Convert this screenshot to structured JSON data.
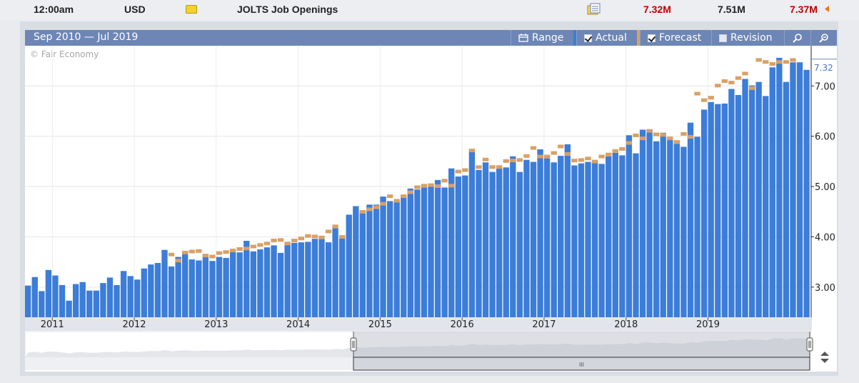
{
  "event_row": {
    "time": "12:00am",
    "currency": "USD",
    "event_name": "JOLTS Job Openings",
    "actual": "7.32M",
    "forecast": "7.51M",
    "previous": "7.37M",
    "impact_icon": "yellow-folder-icon",
    "detail_icon": "document-icon",
    "actual_color": "#c00000",
    "previous_color": "#c00000"
  },
  "chart_header": {
    "range_text": "Sep 2010 — Jul 2019",
    "range_label": "Range",
    "actual_label": "Actual",
    "forecast_label": "Forecast",
    "revision_label": "Revision",
    "actual_checked": true,
    "forecast_checked": true,
    "revision_checked": false,
    "zoom_in_icon": "zoom-in-icon",
    "zoom_out_icon": "zoom-out-icon"
  },
  "copyright": "© Fair Economy",
  "navigator": {
    "scroll_grip": "III"
  },
  "chart_data": {
    "type": "bar",
    "ylim": [
      2.4,
      7.8
    ],
    "yticks": [
      3.0,
      4.0,
      5.0,
      6.0,
      7.0
    ],
    "ytick_labels": [
      "3.00",
      "4.00",
      "5.00",
      "6.00",
      "7.00"
    ],
    "latest_value_label": "7.32",
    "x_labels": [
      "2011",
      "2012",
      "2013",
      "2014",
      "2015",
      "2016",
      "2017",
      "2018",
      "2019"
    ],
    "first_label_index": 4,
    "legend": [
      "Actual",
      "Forecast"
    ],
    "colors": {
      "actual": "#3b7dd8",
      "forecast": "#d9a066",
      "grid": "#e6e6e6"
    },
    "grid": true,
    "actual": [
      3.03,
      3.2,
      2.92,
      3.34,
      3.23,
      3.04,
      2.73,
      3.06,
      3.1,
      2.93,
      2.93,
      3.08,
      3.19,
      3.04,
      3.32,
      3.22,
      3.15,
      3.37,
      3.45,
      3.48,
      3.74,
      3.41,
      3.6,
      3.72,
      3.55,
      3.53,
      3.64,
      3.52,
      3.6,
      3.58,
      3.7,
      3.69,
      3.92,
      3.71,
      3.75,
      3.79,
      3.83,
      3.68,
      3.88,
      3.88,
      3.89,
      3.9,
      3.96,
      3.97,
      3.89,
      4.17,
      3.98,
      4.44,
      4.61,
      4.52,
      4.64,
      4.64,
      4.8,
      4.71,
      4.72,
      4.83,
      4.96,
      4.94,
      4.98,
      5.0,
      5.13,
      4.98,
      5.36,
      5.2,
      5.22,
      5.72,
      5.33,
      5.48,
      5.29,
      5.37,
      5.38,
      5.6,
      5.29,
      5.53,
      5.49,
      5.74,
      5.56,
      5.48,
      5.61,
      5.84,
      5.42,
      5.46,
      5.49,
      5.5,
      5.45,
      5.6,
      5.67,
      5.62,
      6.02,
      5.66,
      6.13,
      6.13,
      5.9,
      6.07,
      5.94,
      5.85,
      5.79,
      6.27,
      5.99,
      6.53,
      6.68,
      6.64,
      6.65,
      6.94,
      6.82,
      7.14,
      7.01,
      7.08,
      6.8,
      7.37,
      7.56,
      7.08,
      7.47,
      7.47,
      7.32
    ],
    "forecast": [
      null,
      null,
      null,
      null,
      null,
      null,
      null,
      null,
      null,
      null,
      null,
      null,
      null,
      null,
      null,
      null,
      null,
      null,
      null,
      null,
      null,
      3.64,
      3.52,
      3.68,
      3.7,
      3.71,
      3.62,
      3.6,
      3.67,
      3.69,
      3.72,
      3.75,
      3.76,
      3.8,
      3.83,
      3.86,
      3.92,
      3.93,
      3.86,
      3.92,
      3.96,
      4.01,
      4.0,
      3.98,
      4.1,
      4.2,
      3.99,
      null,
      null,
      4.49,
      4.54,
      4.58,
      4.65,
      4.8,
      4.71,
      4.8,
      4.88,
      4.98,
      5.01,
      5.02,
      5.0,
      5.11,
      5.01,
      5.29,
      5.32,
      5.71,
      5.38,
      5.53,
      5.38,
      5.38,
      5.5,
      5.51,
      5.52,
      5.6,
      5.76,
      5.59,
      5.59,
      5.66,
      5.79,
      5.64,
      5.51,
      5.52,
      5.55,
      5.49,
      5.59,
      5.63,
      5.7,
      5.74,
      5.86,
      6.01,
      5.95,
      6.1,
      6.03,
      6.02,
      5.95,
      5.88,
      6.04,
      5.98,
      6.84,
      6.71,
      6.76,
      7.0,
      7.09,
      7.06,
      7.15,
      7.24,
      6.95,
      7.51,
      7.47,
      7.43,
      7.47,
      7.47,
      7.51
    ]
  }
}
